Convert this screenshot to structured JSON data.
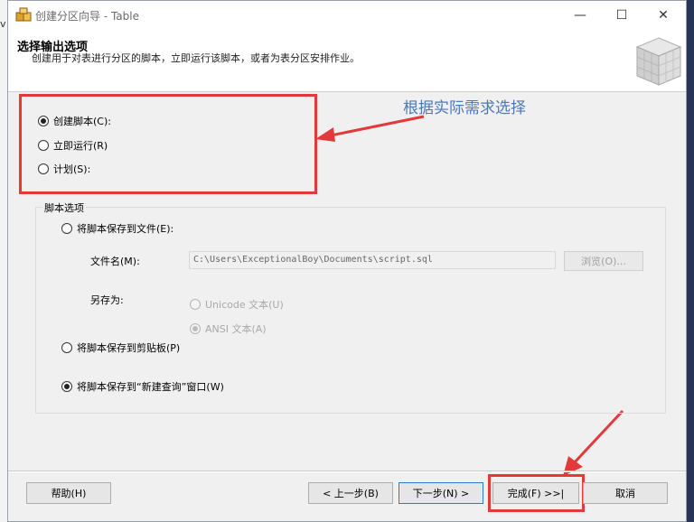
{
  "background": {
    "stray_text": "v"
  },
  "window": {
    "title": "创建分区向导 - Table",
    "controls": {
      "min": "—",
      "max": "☐",
      "close": "✕"
    }
  },
  "header": {
    "title": "选择输出选项",
    "description": "创建用于对表进行分区的脚本，立即运行该脚本，或者为表分区安排作业。"
  },
  "options": [
    {
      "label": "创建脚本(C):",
      "checked": true
    },
    {
      "label": "立即运行(R)",
      "checked": false
    },
    {
      "label": "计划(S):",
      "checked": false
    }
  ],
  "annotation": {
    "text": "根据实际需求选择",
    "color": "#e23a3a"
  },
  "script_options": {
    "legend": "脚本选项",
    "save_to_file": {
      "label": "将脚本保存到文件(E):",
      "checked": false
    },
    "file_name_label": "文件名(M):",
    "file_path": "C:\\Users\\ExceptionalBoy\\Documents\\script.sql",
    "browse_label": "浏览(O)...",
    "save_as_label": "另存为:",
    "unicode_label": "Unicode 文本(U)",
    "ansi_label": "ANSI 文本(A)",
    "save_to_clipboard": {
      "label": "将脚本保存到剪贴板(P)",
      "checked": false
    },
    "save_to_query": {
      "label": "将脚本保存到“新建查询”窗口(W)",
      "checked": true
    }
  },
  "footer": {
    "help": "帮助(H)",
    "prev": "< 上一步(B)",
    "next": "下一步(N) >",
    "finish": "完成(F) >>|",
    "cancel": "取消"
  }
}
